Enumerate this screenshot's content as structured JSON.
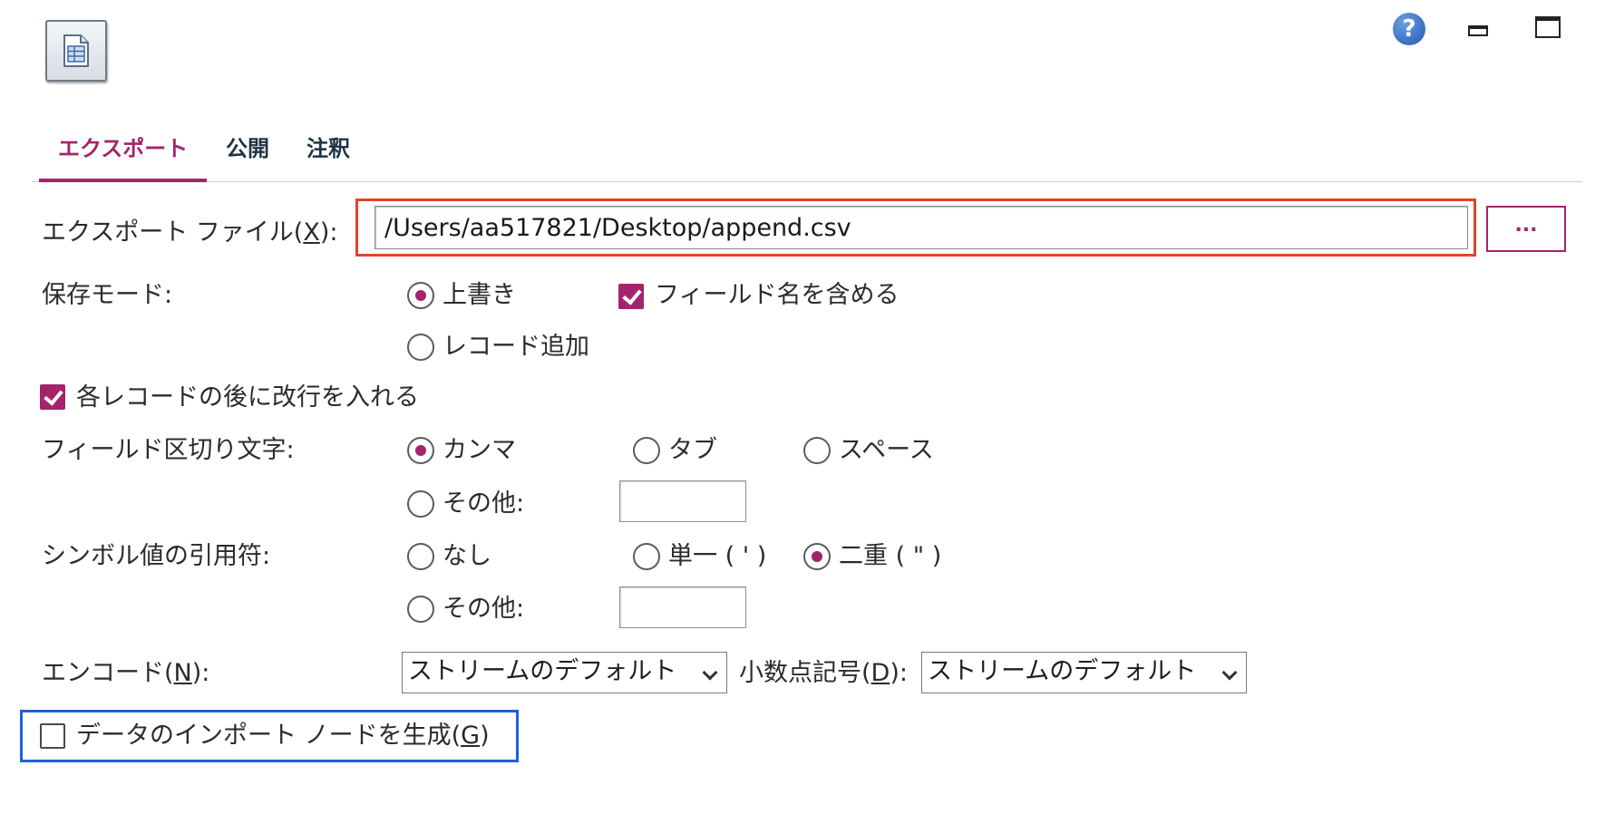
{
  "header": {
    "node_icon": "table-document-icon",
    "help_icon": "help-icon",
    "help_glyph": "?",
    "minimize_icon": "minimize-icon",
    "maximize_icon": "maximize-icon"
  },
  "tabs": [
    {
      "label": "エクスポート",
      "active": true
    },
    {
      "label": "公開",
      "active": false
    },
    {
      "label": "注釈",
      "active": false
    }
  ],
  "export_file": {
    "label_prefix": "エクスポート ファイル(",
    "label_mnemonic": "X",
    "label_suffix": "):",
    "value": "/Users/aa517821/Desktop/append.csv",
    "browse_label": "..."
  },
  "save_mode": {
    "label": "保存モード:",
    "overwrite_label": "上書き",
    "append_label": "レコード追加",
    "selected": "上書き",
    "include_field_names_label": "フィールド名を含める",
    "include_field_names_checked": true
  },
  "newline_after_record": {
    "label": "各レコードの後に改行を入れる",
    "checked": true
  },
  "field_delimiter": {
    "label": "フィールド区切り文字:",
    "comma_label": "カンマ",
    "tab_label": "タブ",
    "space_label": "スペース",
    "other_label": "その他:",
    "other_value": "",
    "selected": "カンマ"
  },
  "symbol_quotes": {
    "label": "シンボル値の引用符:",
    "none_label": "なし",
    "single_label": "単一 ( ' )",
    "double_label": "二重 ( \" )",
    "other_label": "その他:",
    "other_value": "",
    "selected": "二重 ( \" )"
  },
  "encoding": {
    "label_prefix": "エンコード(",
    "label_mnemonic": "N",
    "label_suffix": "):",
    "value": "ストリームのデフォルト"
  },
  "decimal_symbol": {
    "label_prefix": "小数点記号(",
    "label_mnemonic": "D",
    "label_suffix": "):",
    "value": "ストリームのデフォルト"
  },
  "generate_import_node": {
    "label_prefix": "データのインポート ノードを生成(",
    "label_mnemonic": "G",
    "label_suffix": ")",
    "checked": false
  },
  "colors": {
    "accent": "#a3246b",
    "highlight_red": "#e04427",
    "highlight_blue": "#1f5fe0",
    "tab_inactive": "#1f3346"
  }
}
